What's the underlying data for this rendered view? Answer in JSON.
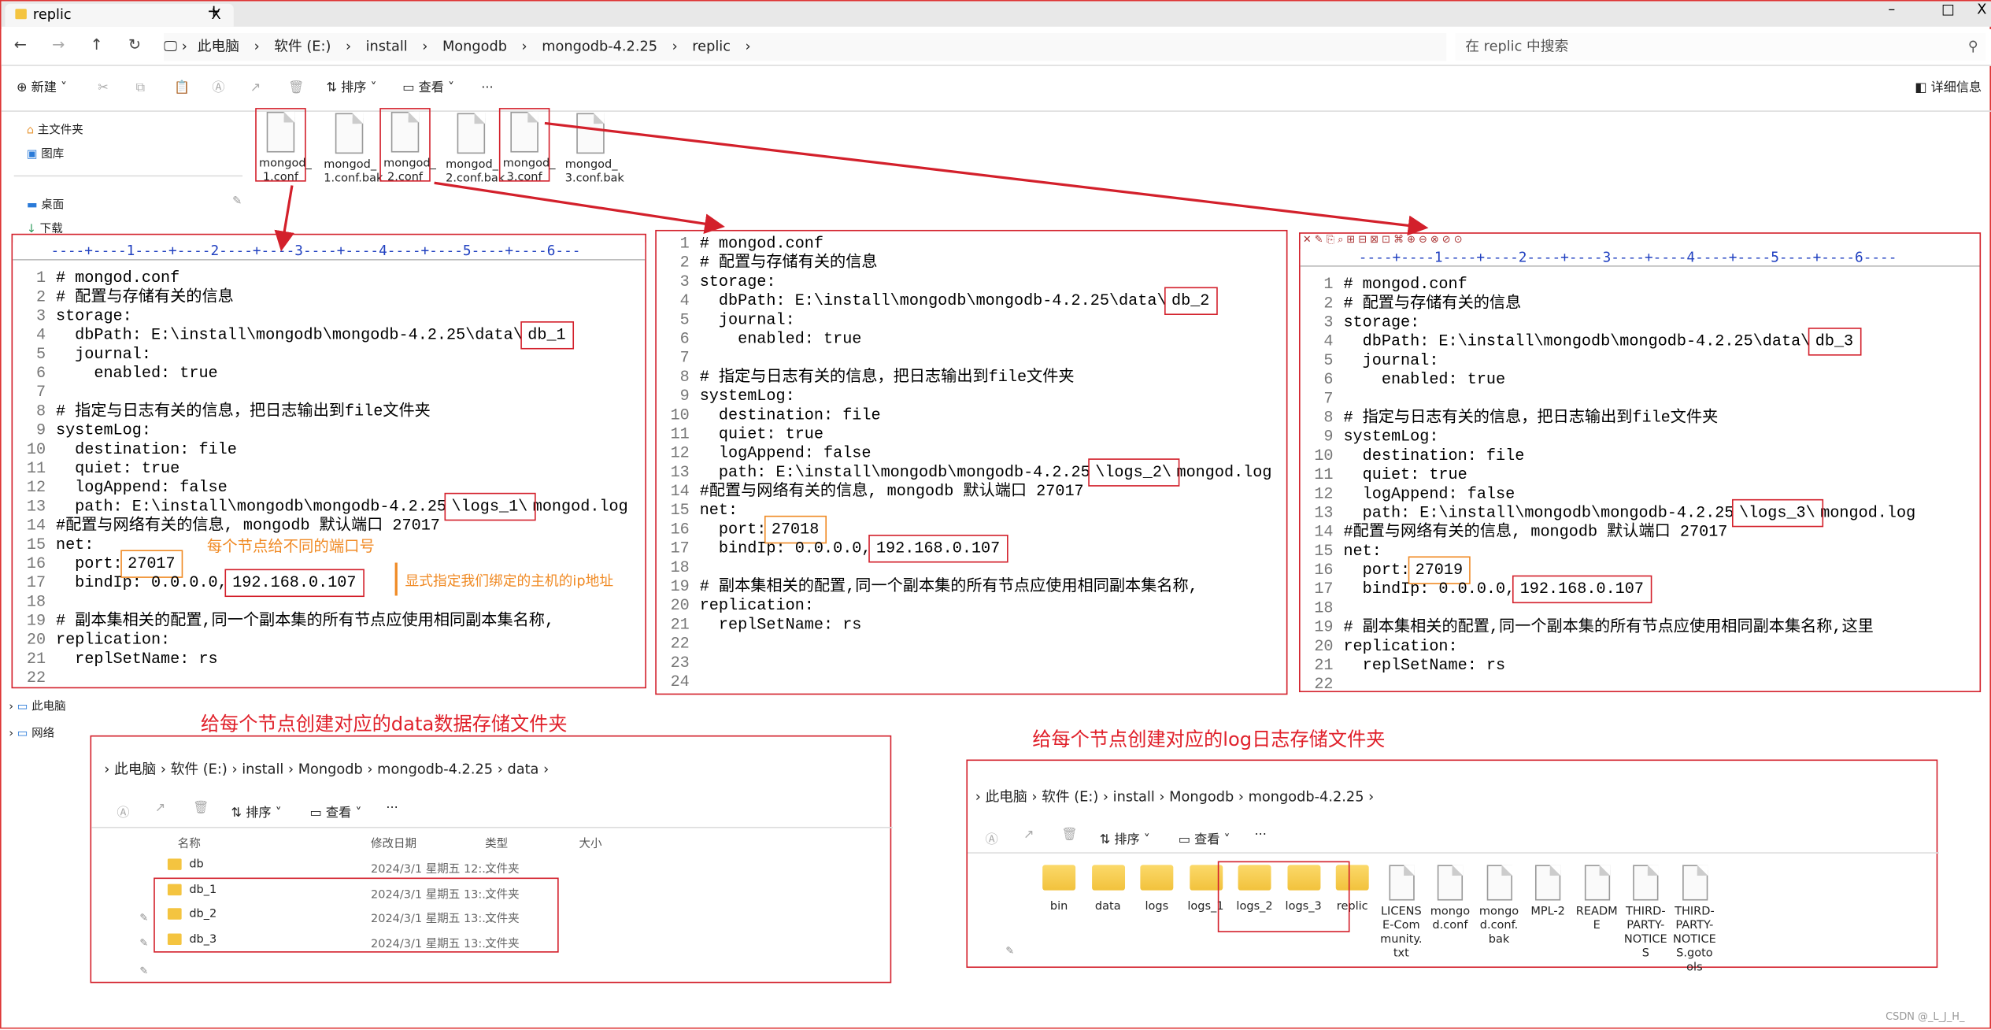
{
  "window": {
    "tab_title": "replic",
    "new_tab": "+",
    "close_tab": "X",
    "min": "–",
    "max": "□",
    "close": "X"
  },
  "address": {
    "crumbs": [
      "此电脑",
      "软件 (E:)",
      "install",
      "Mongodb",
      "mongodb-4.2.25",
      "replic"
    ],
    "search_placeholder": "在 replic 中搜索"
  },
  "toolbar": {
    "new": "新建",
    "sort": "排序",
    "view": "查看",
    "more": "···",
    "details": "详细信息"
  },
  "sidebar": {
    "items": [
      "主文件夹",
      "图库",
      "桌面",
      "下载"
    ],
    "bottom": [
      "此电脑",
      "网络"
    ]
  },
  "files": [
    {
      "name": "mongod_\n1.conf",
      "hl": true
    },
    {
      "name": "mongod_\n1.conf.bak"
    },
    {
      "name": "mongod_\n2.conf",
      "hl": true
    },
    {
      "name": "mongod_\n2.conf.bak"
    },
    {
      "name": "mongod_\n3.conf",
      "hl": true
    },
    {
      "name": "mongod_\n3.conf.bak"
    }
  ],
  "editors": [
    {
      "ruler": "----+----1----+----2----+----3----+----4----+----5----+----6---",
      "lines": [
        [
          "# mongod.conf"
        ],
        [
          "# 配置与存储有关的信息"
        ],
        [
          "storage:"
        ],
        [
          "  dbPath: E:\\install\\mongodb\\mongodb-4.2.25\\data\\",
          {
            "t": "db_1",
            "box": "red"
          }
        ],
        [
          "  journal:"
        ],
        [
          "    enabled: true"
        ],
        [
          ""
        ],
        [
          "# 指定与日志有关的信息，把日志输出到file文件夹"
        ],
        [
          "systemLog:"
        ],
        [
          "  destination: file"
        ],
        [
          "  quiet: true"
        ],
        [
          "  logAppend: false"
        ],
        [
          "  path: E:\\install\\mongodb\\mongodb-4.2.25",
          {
            "t": "\\logs_1\\",
            "box": "red"
          },
          "mongod.log"
        ],
        [
          "#配置与网络有关的信息, mongodb 默认端口 27017"
        ],
        [
          "net:"
        ],
        [
          "  port:",
          {
            "t": "27017",
            "box": "orange"
          }
        ],
        [
          "  bindIp: 0.0.0.0,",
          {
            "t": "192.168.0.107",
            "box": "red"
          }
        ],
        [
          ""
        ],
        [
          "# 副本集相关的配置,同一个副本集的所有节点应使用相同副本集名称,"
        ],
        [
          "replication:"
        ],
        [
          "  replSetName: rs"
        ],
        [
          ""
        ]
      ]
    },
    {
      "ruler": "",
      "lines": [
        [
          "# mongod.conf"
        ],
        [
          "# 配置与存储有关的信息"
        ],
        [
          "storage:"
        ],
        [
          "  dbPath: E:\\install\\mongodb\\mongodb-4.2.25\\data\\",
          {
            "t": "db_2",
            "box": "red"
          }
        ],
        [
          "  journal:"
        ],
        [
          "    enabled: true"
        ],
        [
          ""
        ],
        [
          "# 指定与日志有关的信息，把日志输出到file文件夹"
        ],
        [
          "systemLog:"
        ],
        [
          "  destination: file"
        ],
        [
          "  quiet: true"
        ],
        [
          "  logAppend: false"
        ],
        [
          "  path: E:\\install\\mongodb\\mongodb-4.2.25",
          {
            "t": "\\logs_2\\",
            "box": "red"
          },
          "mongod.log"
        ],
        [
          "#配置与网络有关的信息, mongodb 默认端口 27017"
        ],
        [
          "net:"
        ],
        [
          "  port:",
          {
            "t": "27018",
            "box": "orange"
          }
        ],
        [
          "  bindIp: 0.0.0.0,",
          {
            "t": "192.168.0.107",
            "box": "red"
          }
        ],
        [
          ""
        ],
        [
          "# 副本集相关的配置,同一个副本集的所有节点应使用相同副本集名称,"
        ],
        [
          "replication:"
        ],
        [
          "  replSetName: rs"
        ],
        [
          ""
        ],
        [
          ""
        ],
        [
          ""
        ]
      ]
    },
    {
      "ruler": "----+----1----+----2----+----3----+----4----+----5----+----6----",
      "lines": [
        [
          "# mongod.conf"
        ],
        [
          "# 配置与存储有关的信息"
        ],
        [
          "storage:"
        ],
        [
          "  dbPath: E:\\install\\mongodb\\mongodb-4.2.25\\data\\",
          {
            "t": "db_3",
            "box": "red"
          }
        ],
        [
          "  journal:"
        ],
        [
          "    enabled: true"
        ],
        [
          ""
        ],
        [
          "# 指定与日志有关的信息，把日志输出到file文件夹"
        ],
        [
          "systemLog:"
        ],
        [
          "  destination: file"
        ],
        [
          "  quiet: true"
        ],
        [
          "  logAppend: false"
        ],
        [
          "  path: E:\\install\\mongodb\\mongodb-4.2.25",
          {
            "t": "\\logs_3\\",
            "box": "red"
          },
          "mongod.log"
        ],
        [
          "#配置与网络有关的信息, mongodb 默认端口 27017"
        ],
        [
          "net:"
        ],
        [
          "  port:",
          {
            "t": "27019",
            "box": "orange"
          }
        ],
        [
          "  bindIp: 0.0.0.0,",
          {
            "t": "192.168.0.107",
            "box": "red"
          }
        ],
        [
          ""
        ],
        [
          "# 副本集相关的配置,同一个副本集的所有节点应使用相同副本集名称,这里"
        ],
        [
          "replication:"
        ],
        [
          "  replSetName: rs"
        ],
        [
          ""
        ]
      ]
    }
  ],
  "notes": {
    "port": "每个节点给不同的端口号",
    "ip": "显式指定我们绑定的主机的ip地址",
    "data_heading": "给每个节点创建对应的data数据存储文件夹",
    "log_heading": "给每个节点创建对应的log日志存储文件夹"
  },
  "data_explorer": {
    "crumbs": [
      "此电脑",
      "软件 (E:)",
      "install",
      "Mongodb",
      "mongodb-4.2.25",
      "data"
    ],
    "columns": [
      "名称",
      "修改日期",
      "类型",
      "大小"
    ],
    "rows": [
      [
        "db",
        "2024/3/1  星期五 12:...",
        "文件夹"
      ],
      [
        "db_1",
        "2024/3/1  星期五 13:...",
        "文件夹"
      ],
      [
        "db_2",
        "2024/3/1  星期五 13:...",
        "文件夹"
      ],
      [
        "db_3",
        "2024/3/1  星期五 13:...",
        "文件夹"
      ]
    ]
  },
  "mongo_explorer": {
    "crumbs": [
      "此电脑",
      "软件 (E:)",
      "install",
      "Mongodb",
      "mongodb-4.2.25"
    ],
    "items": [
      {
        "name": "bin",
        "kind": "folder"
      },
      {
        "name": "data",
        "kind": "folder"
      },
      {
        "name": "logs",
        "kind": "folder"
      },
      {
        "name": "logs_1",
        "kind": "folder"
      },
      {
        "name": "logs_2",
        "kind": "folder"
      },
      {
        "name": "logs_3",
        "kind": "folder"
      },
      {
        "name": "replic",
        "kind": "folder"
      },
      {
        "name": "LICENSE-Community.txt",
        "kind": "file"
      },
      {
        "name": "mongod.conf",
        "kind": "file"
      },
      {
        "name": "mongod.conf.bak",
        "kind": "file"
      },
      {
        "name": "MPL-2",
        "kind": "file"
      },
      {
        "name": "README",
        "kind": "file"
      },
      {
        "name": "THIRD-PARTY-NOTICES",
        "kind": "file"
      },
      {
        "name": "THIRD-PARTY-NOTICES.gotools",
        "kind": "file"
      }
    ]
  },
  "watermark": "CSDN @_L_J_H_",
  "colors": {
    "annotation_red": "#d3202b",
    "annotation_orange": "#f08a24"
  }
}
